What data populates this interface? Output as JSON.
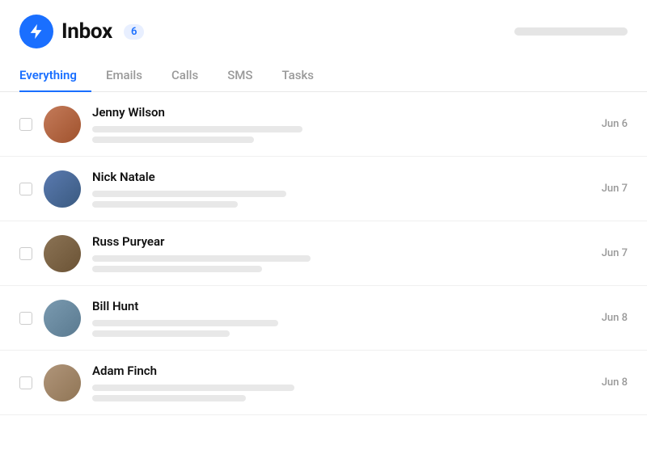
{
  "header": {
    "title": "Inbox",
    "badge": "6",
    "logo_icon": "bolt"
  },
  "tabs": [
    {
      "label": "Everything",
      "active": true
    },
    {
      "label": "Emails",
      "active": false
    },
    {
      "label": "Calls",
      "active": false
    },
    {
      "label": "SMS",
      "active": false
    },
    {
      "label": "Tasks",
      "active": false
    }
  ],
  "contacts": [
    {
      "name": "Jenny Wilson",
      "date": "Jun 6",
      "avatar_class": "avatar-jenny",
      "line_widths": [
        "260px",
        "200px"
      ]
    },
    {
      "name": "Nick Natale",
      "date": "Jun 7",
      "avatar_class": "avatar-nick",
      "line_widths": [
        "240px",
        "180px"
      ]
    },
    {
      "name": "Russ Puryear",
      "date": "Jun 7",
      "avatar_class": "avatar-russ",
      "line_widths": [
        "270px",
        "210px"
      ]
    },
    {
      "name": "Bill Hunt",
      "date": "Jun 8",
      "avatar_class": "avatar-bill",
      "line_widths": [
        "230px",
        "170px"
      ]
    },
    {
      "name": "Adam Finch",
      "date": "Jun 8",
      "avatar_class": "avatar-adam",
      "line_widths": [
        "250px",
        "190px"
      ]
    }
  ]
}
